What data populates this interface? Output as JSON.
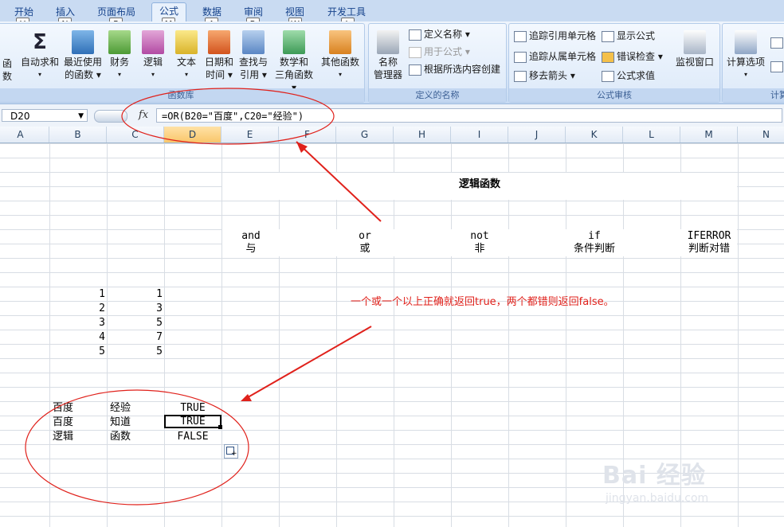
{
  "ribbon": {
    "tabs": [
      {
        "label": "开始",
        "key": "H"
      },
      {
        "label": "插入",
        "key": "N"
      },
      {
        "label": "页面布局",
        "key": "P"
      },
      {
        "label": "公式",
        "key": "M"
      },
      {
        "label": "数据",
        "key": "A"
      },
      {
        "label": "审阅",
        "key": "R"
      },
      {
        "label": "视图",
        "key": "W"
      },
      {
        "label": "开发工具",
        "key": "L"
      }
    ],
    "groups": {
      "function_library": "函数库",
      "defined_names": "定义的名称",
      "formula_auditing": "公式审核",
      "calculation": "计算"
    },
    "buttons": {
      "truncated_left": "函数",
      "autosum": "自动求和",
      "recent_1": "最近使用",
      "recent_2": "的函数",
      "financial": "财务",
      "logical": "逻辑",
      "text": "文本",
      "datetime_1": "日期和",
      "datetime_2": "时间",
      "lookup_1": "查找与",
      "lookup_2": "引用",
      "math_1": "数学和",
      "math_2": "三角函数",
      "other": "其他函数",
      "name_mgr_1": "名称",
      "name_mgr_2": "管理器",
      "define_name": "定义名称",
      "use_in_formula": "用于公式",
      "create_from_sel": "根据所选内容创建",
      "trace_precedents": "追踪引用单元格",
      "trace_dependents": "追踪从属单元格",
      "remove_arrows": "移去箭头",
      "show_formulas": "显示公式",
      "error_checking": "错误检查",
      "evaluate_formula": "公式求值",
      "watch_window": "监视窗口",
      "calc_options": "计算选项"
    }
  },
  "formula_bar": {
    "name_box": "D20",
    "fx": "fx",
    "formula": "=OR(B20=\"百度\",C20=\"经验\")"
  },
  "columns": [
    "A",
    "B",
    "C",
    "D",
    "E",
    "F",
    "G",
    "H",
    "I",
    "J",
    "K",
    "L",
    "M",
    "N"
  ],
  "sheet": {
    "title": "逻辑函数",
    "functions": [
      {
        "name": "and",
        "desc": "与"
      },
      {
        "name": "or",
        "desc": "或"
      },
      {
        "name": "not",
        "desc": "非"
      },
      {
        "name": "if",
        "desc": "条件判断"
      },
      {
        "name": "IFERROR",
        "desc": "判断对错"
      }
    ],
    "numbers": [
      [
        1,
        1
      ],
      [
        2,
        3
      ],
      [
        3,
        5
      ],
      [
        4,
        7
      ],
      [
        5,
        5
      ]
    ],
    "rows": [
      {
        "b": "百度",
        "c": "经验",
        "d": "TRUE"
      },
      {
        "b": "百度",
        "c": "知道",
        "d": "TRUE"
      },
      {
        "b": "逻辑",
        "c": "函数",
        "d": "FALSE"
      }
    ],
    "annotation": "一个或一个以上正确就返回true，两个都错则返回false。"
  },
  "watermark": {
    "brand": "Bai 经验",
    "url": "jingyan.baidu.com"
  },
  "colors": {
    "annotation_red": "#e0211b",
    "ribbon_text": "#15428b"
  }
}
